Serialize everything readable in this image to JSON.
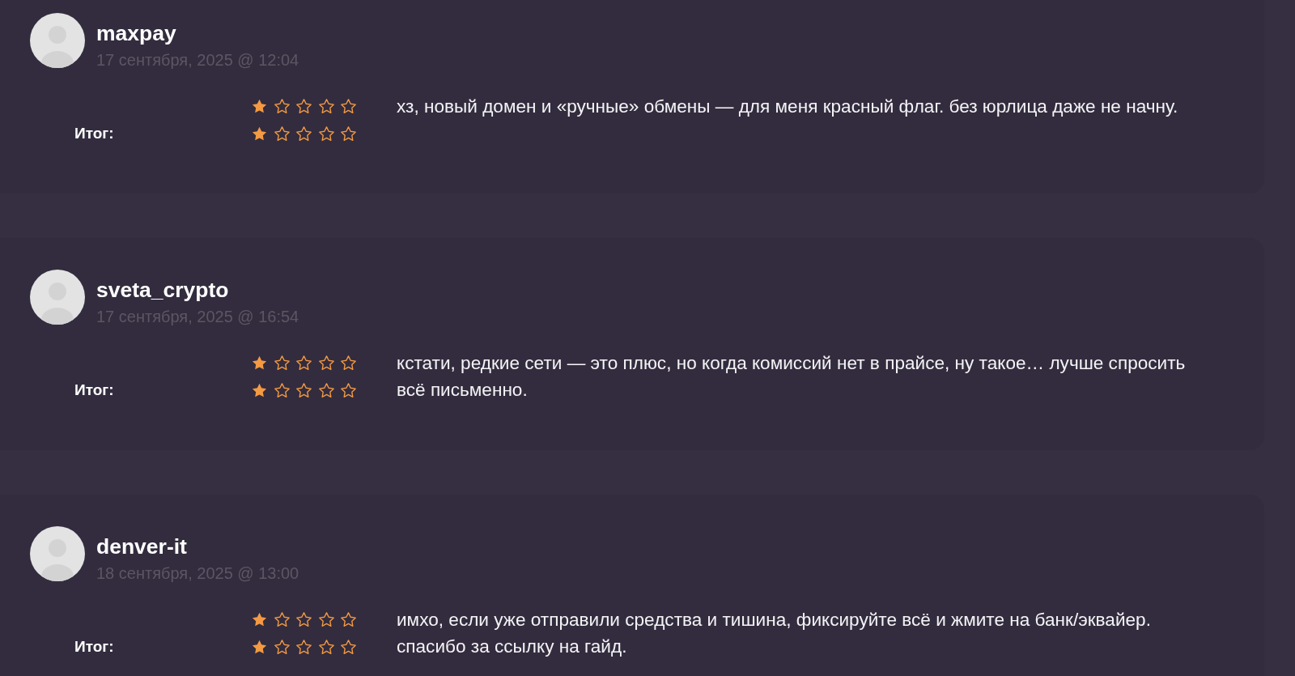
{
  "reviews": [
    {
      "author": "maxpay",
      "date": "17 сентября, 2025 @ 12:04",
      "ratings": [
        {
          "stars": 1
        },
        {
          "label": "Итог:",
          "stars": 1
        }
      ],
      "comment": "хз, новый домен и «ручные» обмены — для меня красный флаг. без юрлица даже не начну."
    },
    {
      "author": "sveta_crypto",
      "date": "17 сентября, 2025 @ 16:54",
      "ratings": [
        {
          "stars": 1
        },
        {
          "label": "Итог:",
          "stars": 1
        }
      ],
      "comment": "кстати, редкие сети — это плюс, но когда комиссий нет в прайсе, ну такое… лучше спросить всё письменно."
    },
    {
      "author": "denver-it",
      "date": "18 сентября, 2025 @ 13:00",
      "ratings": [
        {
          "stars": 1
        },
        {
          "label": "Итог:",
          "stars": 1
        }
      ],
      "comment": "имхо, если уже отправили средства и тишина, фиксируйте всё и жмите на банк/эквайер. спасибо за ссылку на гайд."
    }
  ]
}
